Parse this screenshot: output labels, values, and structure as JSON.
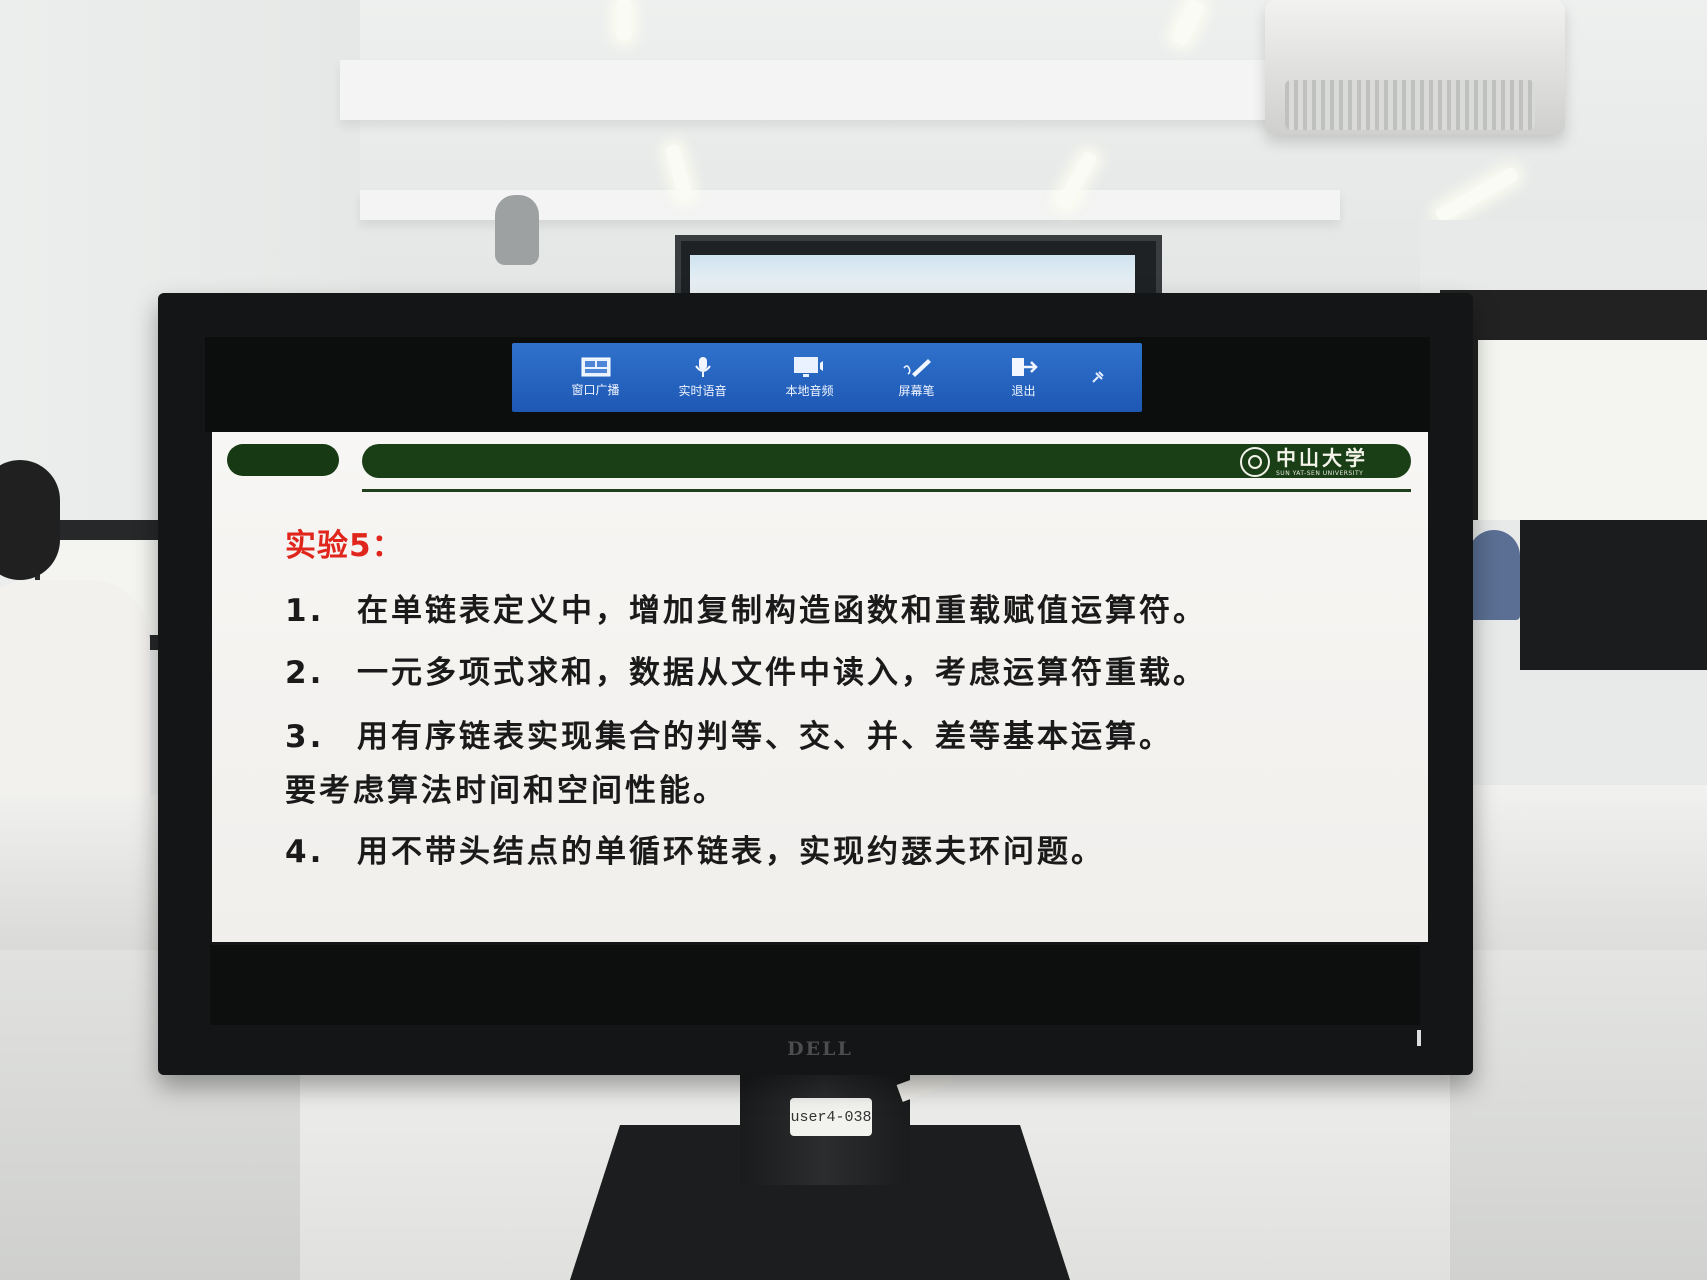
{
  "toolbar": {
    "buttons": [
      {
        "label": "窗口广播",
        "icon": "window-broadcast-icon"
      },
      {
        "label": "实时语音",
        "icon": "microphone-icon"
      },
      {
        "label": "本地音频",
        "icon": "local-audio-icon"
      },
      {
        "label": "屏幕笔",
        "icon": "screen-pen-icon"
      },
      {
        "label": "退出",
        "icon": "exit-icon"
      }
    ],
    "pin_icon": "pin-icon"
  },
  "slide": {
    "university_name": "中山大学",
    "university_name_en": "SUN YAT-SEN UNIVERSITY",
    "title": "实验5：",
    "items": [
      {
        "num": "1.",
        "text": "在单链表定义中，增加复制构造函数和重载赋值运算符。"
      },
      {
        "num": "2.",
        "text": "一元多项式求和，数据从文件中读入，考虑运算符重载。"
      },
      {
        "num": "3.",
        "text": "用有序链表实现集合的判等、交、并、差等基本运算。",
        "continuation": "要考虑算法时间和空间性能。"
      },
      {
        "num": "4.",
        "text": "用不带头结点的单循环链表，实现约瑟夫环问题。"
      }
    ]
  },
  "monitor": {
    "brand": "DELL",
    "asset_label": "user4-038"
  },
  "colors": {
    "toolbar_blue": "#2461be",
    "slide_green": "#1a3f17",
    "title_red": "#e0261c"
  }
}
